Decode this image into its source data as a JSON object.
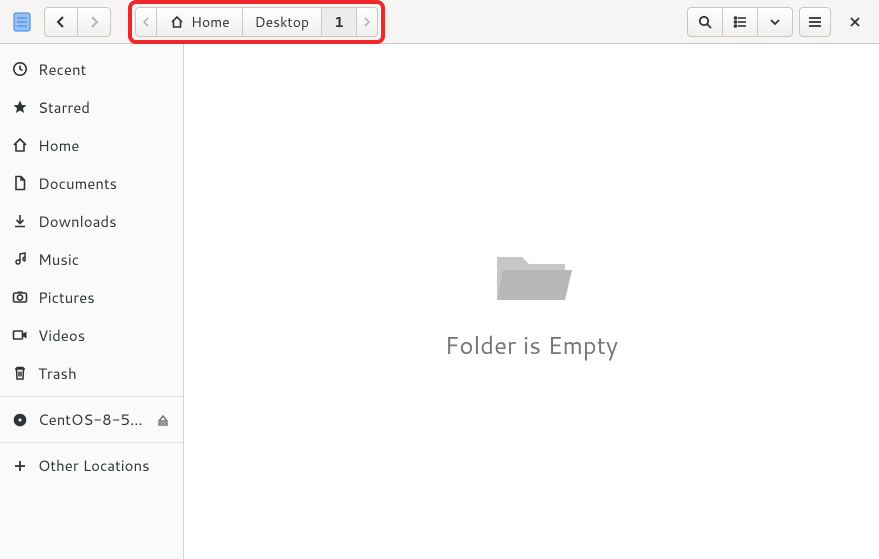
{
  "toolbar": {
    "path": {
      "home_label": "Home",
      "seg2": "Desktop",
      "seg3": "1"
    }
  },
  "sidebar": {
    "items": [
      {
        "label": "Recent"
      },
      {
        "label": "Starred"
      },
      {
        "label": "Home"
      },
      {
        "label": "Documents"
      },
      {
        "label": "Downloads"
      },
      {
        "label": "Music"
      },
      {
        "label": "Pictures"
      },
      {
        "label": "Videos"
      },
      {
        "label": "Trash"
      },
      {
        "label": "CentOS-8-5..."
      },
      {
        "label": "Other Locations"
      }
    ]
  },
  "main": {
    "empty_message": "Folder is Empty"
  }
}
